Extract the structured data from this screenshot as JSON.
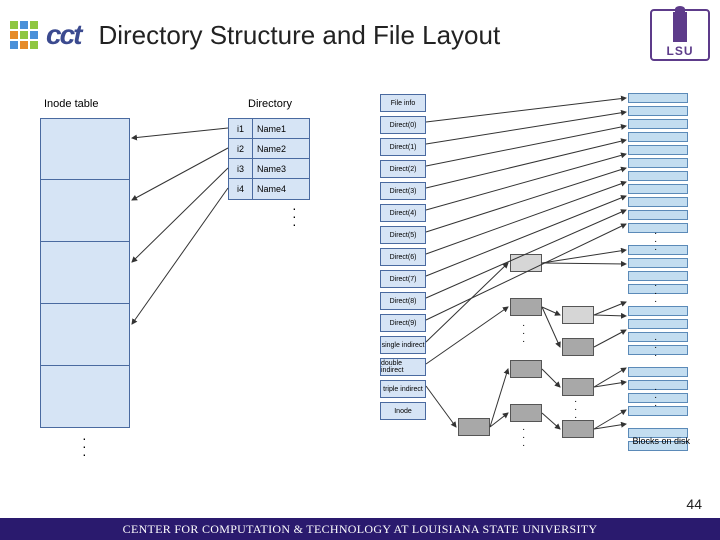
{
  "header": {
    "logo_cct_alt": "cct",
    "title": "Directory Structure and File Layout",
    "logo_lsu_alt": "LSU"
  },
  "labels": {
    "inode_table": "Inode table",
    "directory": "Directory",
    "blocks_on_disk": "Blocks on disk"
  },
  "directory": {
    "rows": [
      {
        "inode": "i1",
        "name": "Name1"
      },
      {
        "inode": "i2",
        "name": "Name2"
      },
      {
        "inode": "i3",
        "name": "Name3"
      },
      {
        "inode": "i4",
        "name": "Name4"
      }
    ]
  },
  "inode_block": {
    "cells": [
      "File info",
      "Direct(0)",
      "Direct(1)",
      "Direct(2)",
      "Direct(3)",
      "Direct(4)",
      "Direct(5)",
      "Direct(6)",
      "Direct(7)",
      "Direct(8)",
      "Direct(9)",
      "single indirect",
      "double indirect",
      "triple indirect",
      "Inode"
    ]
  },
  "page_number": "44",
  "footer": "CENTER FOR COMPUTATION & TECHNOLOGY AT LOUISIANA STATE UNIVERSITY"
}
